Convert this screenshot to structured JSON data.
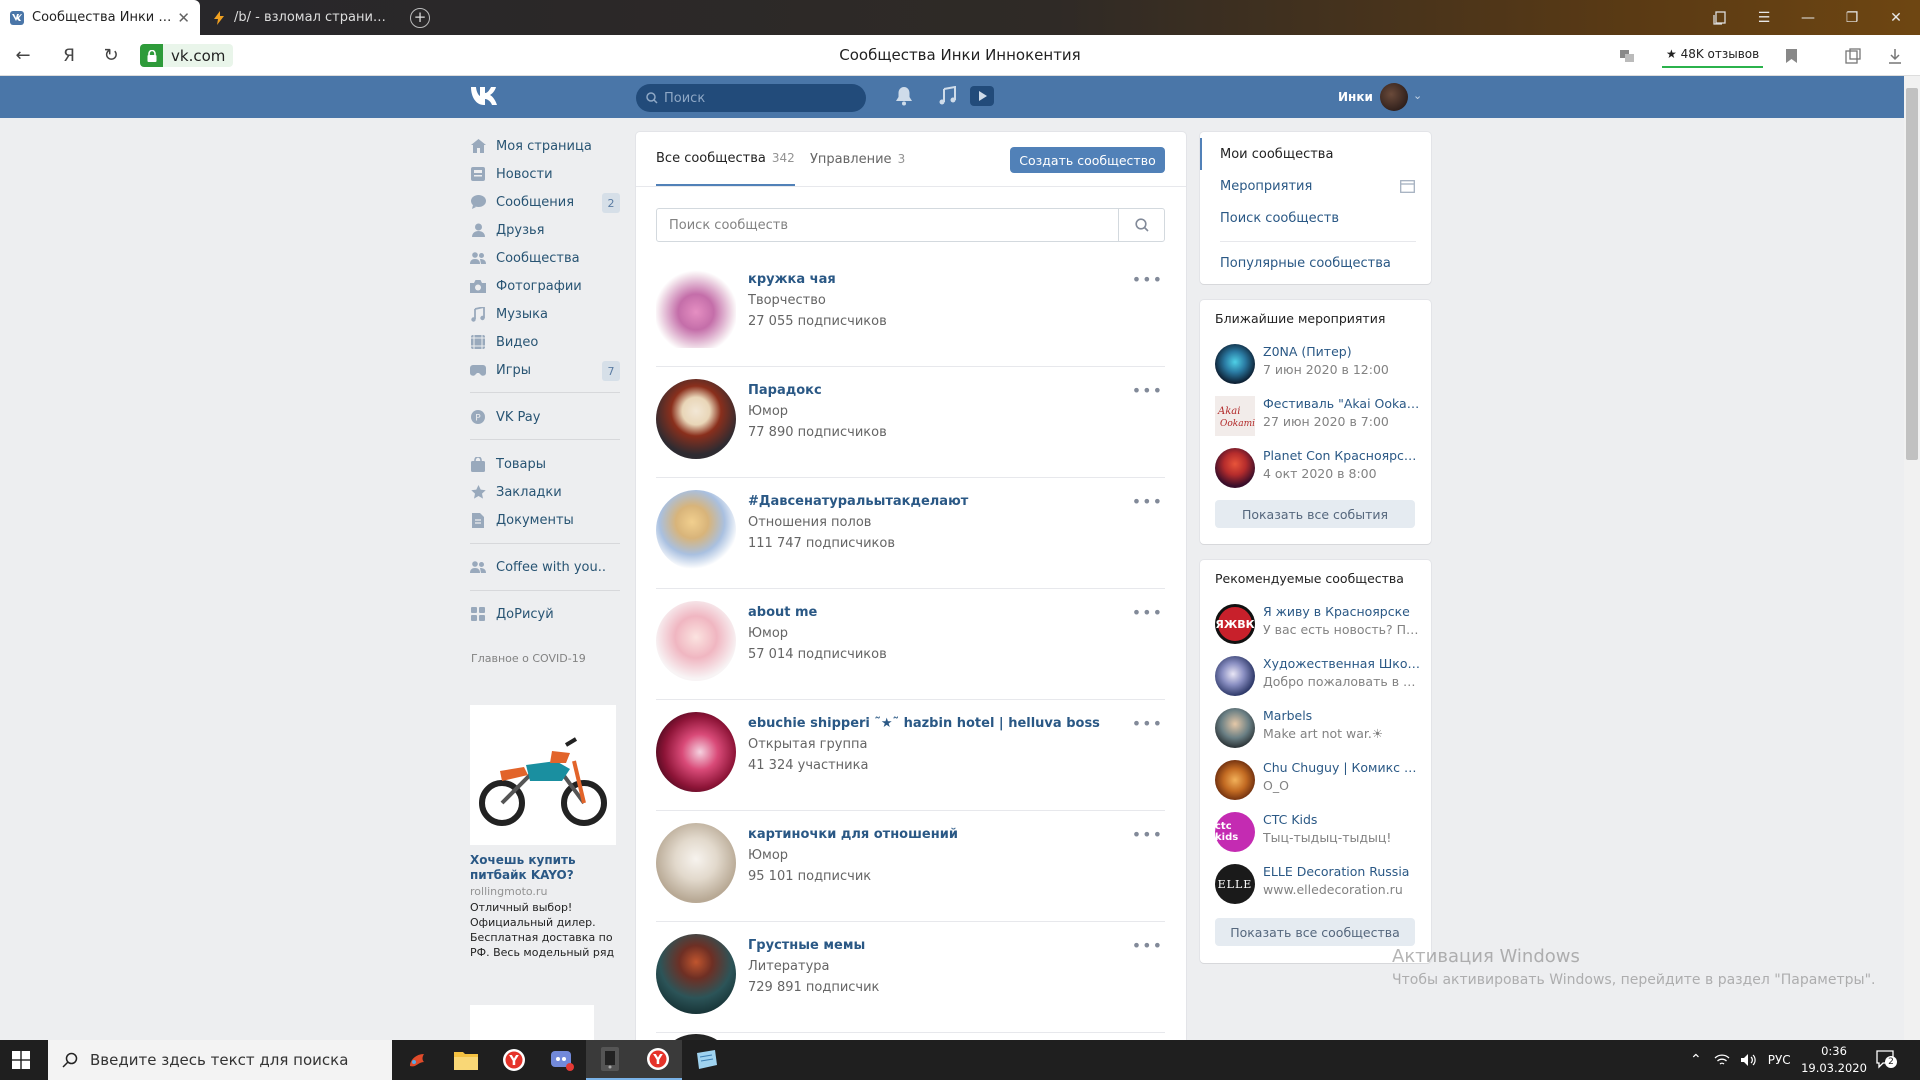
{
  "browser": {
    "tabs": [
      {
        "title": "Сообщества Инки Инн",
        "active": true
      },
      {
        "title": "/b/ - взломал страницу ан",
        "active": false
      }
    ],
    "address": "vk.com",
    "page_title": "Сообщества Инки Иннокентия",
    "reviews_label": "48K отзывов"
  },
  "vk": {
    "search_placeholder": "Поиск",
    "user_name": "Инки",
    "menu": [
      {
        "label": "Моя страница",
        "icon": "home-icon"
      },
      {
        "label": "Новости",
        "icon": "news-icon"
      },
      {
        "label": "Сообщения",
        "icon": "messages-icon",
        "count": "2"
      },
      {
        "label": "Друзья",
        "icon": "friends-icon"
      },
      {
        "label": "Сообщества",
        "icon": "groups-icon"
      },
      {
        "label": "Фотографии",
        "icon": "camera-icon"
      },
      {
        "label": "Музыка",
        "icon": "music-icon"
      },
      {
        "label": "Видео",
        "icon": "video-icon"
      },
      {
        "label": "Игры",
        "icon": "games-icon",
        "count": "7"
      },
      {
        "label": "VK Pay",
        "icon": "vkpay-icon"
      },
      {
        "label": "Товары",
        "icon": "bag-icon"
      },
      {
        "label": "Закладки",
        "icon": "star-icon"
      },
      {
        "label": "Документы",
        "icon": "document-icon"
      },
      {
        "label": "Coffee with you..",
        "icon": "groups-icon"
      },
      {
        "label": "ДоРисуй",
        "icon": "apps-icon"
      }
    ],
    "covid_link": "Главное о COVID-19",
    "ad": {
      "title": "Хочешь купить питбайк KAYO?",
      "site": "rollingmoto.ru",
      "text": "Отличный выбор! Официальный дилер. Бесплатная доставка по РФ. Весь модельный ряд"
    }
  },
  "main": {
    "tab_all": "Все сообщества",
    "tab_all_count": "342",
    "tab_manage": "Управление",
    "tab_manage_count": "3",
    "create_button": "Создать сообщество",
    "search_placeholder": "Поиск сообществ",
    "groups": [
      {
        "name": "кружка чая",
        "category": "Творчество",
        "subscribers": "27 055 подписчиков",
        "color": "#c98bb0"
      },
      {
        "name": "Парадокс",
        "category": "Юмор",
        "subscribers": "77 890 подписчиков",
        "color": "#3b3a3f"
      },
      {
        "name": "#Давсенатуральытакделают",
        "category": "Отношения полов",
        "subscribers": "111 747 подписчиков",
        "color": "#b9c7de"
      },
      {
        "name": "about me",
        "category": "Юмор",
        "subscribers": "57 014 подписчиков",
        "color": "#f0c9cf"
      },
      {
        "name": "ebuchie shipperi ˜★˜ hazbin hotel | helluva boss",
        "category": "Открытая группа",
        "subscribers": "41 324 участника",
        "color": "#a3214b"
      },
      {
        "name": "картиночки для отношений",
        "category": "Юмор",
        "subscribers": "95 101 подписчик",
        "color": "#d8d1c6"
      },
      {
        "name": "Грустные мемы",
        "category": "Литература",
        "subscribers": "729 891 подписчик",
        "color": "#2c5458"
      }
    ]
  },
  "right": {
    "nav": [
      "Мои сообщества",
      "Мероприятия",
      "Поиск сообществ",
      "Популярные сообщества"
    ],
    "events_title": "Ближайшие мероприятия",
    "events": [
      {
        "name": "Z0NA (Питер)",
        "date": "7 июн 2020 в 12:00",
        "color": "#1e3b57"
      },
      {
        "name": "Фестиваль \"Akai Ookami...",
        "date": "27 июн 2020 в 7:00",
        "color": "#e9e2de"
      },
      {
        "name": "Planet Con Красноярск | ...",
        "date": "4 окт 2020 в 8:00",
        "color": "#3a0e2a"
      }
    ],
    "events_button": "Показать все события",
    "rec_title": "Рекомендуемые сообщества",
    "recommended": [
      {
        "name": "Я живу в Красноярске",
        "desc": "У вас есть новость? Пр...",
        "color": "#c8202b",
        "badge": "ЯЖВК"
      },
      {
        "name": "Художественная Школа...",
        "desc": "Добро пожаловать в ую...",
        "color": "#3a4a7a",
        "badge": ""
      },
      {
        "name": "Marbels",
        "desc": "Make art not war.☀",
        "color": "#6a7f84",
        "badge": ""
      },
      {
        "name": "Chu Chuguy | Комикс \"Sh...",
        "desc": "O_O",
        "color": "#b45a1e",
        "badge": ""
      },
      {
        "name": "CTC Kids",
        "desc": "Тыц-тыдыц-тыдыц!",
        "color": "#c42bb2",
        "badge": "ctc kids"
      },
      {
        "name": "ELLE Decoration Russia",
        "desc": "www.elledecoration.ru",
        "color": "#1a1a1a",
        "badge": "ELLE"
      }
    ],
    "rec_button": "Показать все сообщества"
  },
  "watermark": {
    "title": "Активация Windows",
    "text": "Чтобы активировать Windows, перейдите в раздел \"Параметры\"."
  },
  "taskbar": {
    "search_placeholder": "Введите здесь текст для поиска",
    "lang": "РУС",
    "time": "0:36",
    "date": "19.03.2020",
    "notif_count": "2"
  }
}
